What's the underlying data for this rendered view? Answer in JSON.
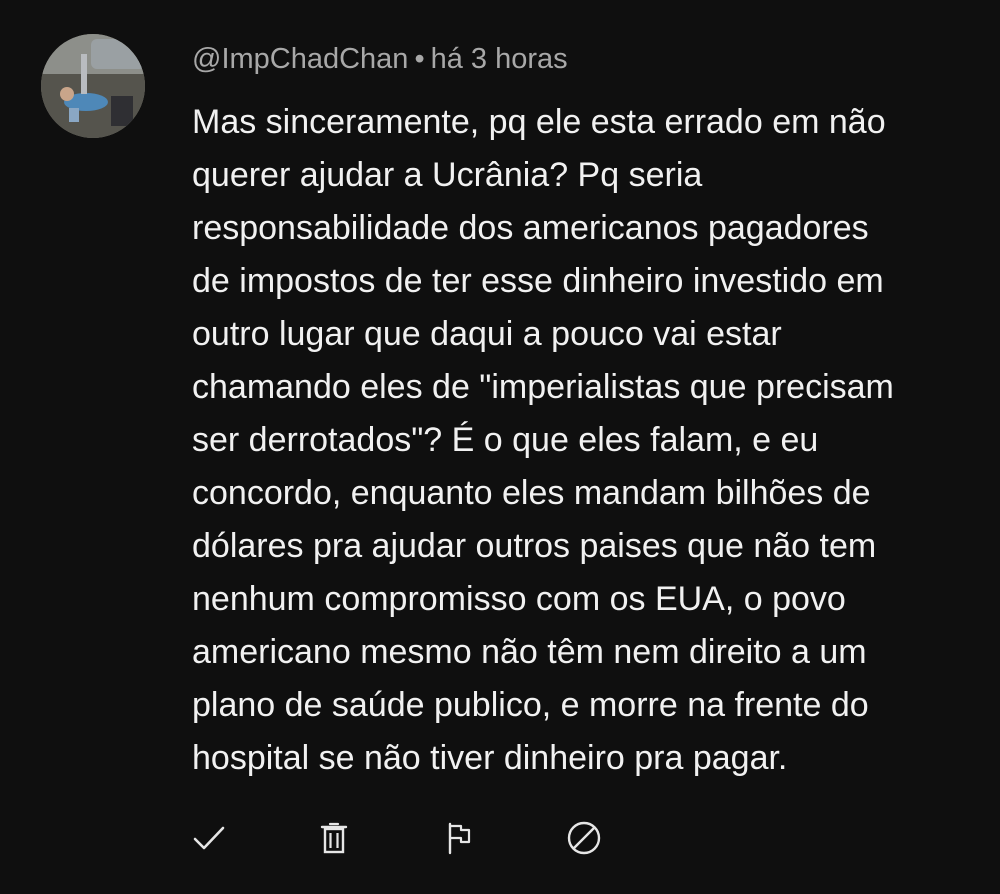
{
  "comment": {
    "author": "@ImpChadChan",
    "separator": "•",
    "timestamp": "há 3 horas",
    "text": "Mas sinceramente, pq ele esta errado em não\nquerer ajudar a Ucrânia? Pq seria\nresponsabilidade dos americanos pagadores\nde impostos de ter esse dinheiro investido em\noutro lugar que daqui a pouco vai estar\nchamando eles de \"imperialistas que precisam\nser derrotados\"? É o que eles falam, e eu\nconcordo, enquanto eles mandam bilhões de\ndólares pra ajudar outros paises que não tem\nnenhum compromisso com os EUA, o povo\namericano mesmo não têm nem direito a um\nplano de saúde publico, e morre na frente do\nhospital se não tiver dinheiro pra pagar."
  },
  "actions": [
    {
      "icon": "check-icon"
    },
    {
      "icon": "trash-icon"
    },
    {
      "icon": "flag-icon"
    },
    {
      "icon": "block-icon"
    }
  ],
  "colors": {
    "background": "#0f0f0f",
    "text": "#f1f1f1",
    "secondary_text": "#a8a8a8",
    "icon": "#e6e6e6"
  }
}
